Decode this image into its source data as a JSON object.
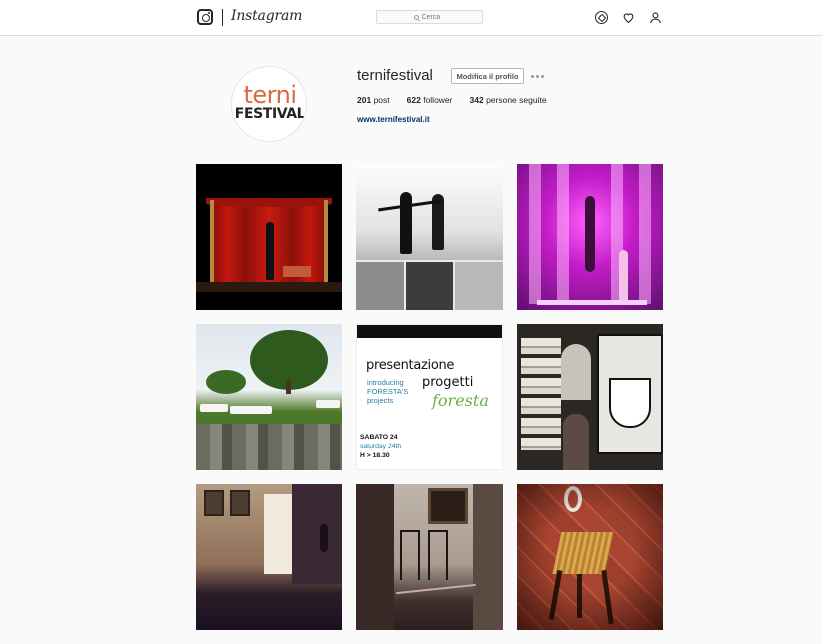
{
  "nav": {
    "wordmark": "Instagram",
    "search_placeholder": "Cerca",
    "icons": [
      "instagram-glyph-icon",
      "compass-icon",
      "heart-icon",
      "person-icon"
    ]
  },
  "profile": {
    "username": "ternifestival",
    "edit_button": "Modifica il profilo",
    "avatar_line1": "terni",
    "avatar_line2": "FESTIVAL",
    "stats": {
      "posts_count": "201",
      "posts_label": "post",
      "followers_count": "622",
      "followers_label": "follower",
      "following_count": "342",
      "following_label": "persone seguite"
    },
    "website": "www.ternifestival.it"
  },
  "grid": {
    "poster": {
      "line1": "presentazione",
      "line2": "progetti",
      "line3": "introducing",
      "line4": "FORESTA'S",
      "line5": "projects",
      "script": "foresta",
      "date1": "SABATO 24",
      "date2": "saturday 24th",
      "time": "H > 18.30"
    }
  },
  "colors": {
    "link": "#003569",
    "background": "#fafafa",
    "border": "#dbdbdb"
  }
}
